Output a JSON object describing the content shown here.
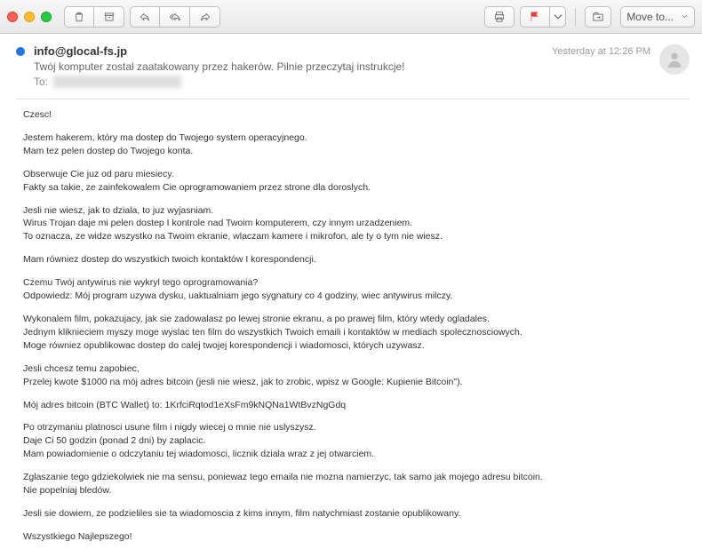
{
  "toolbar": {
    "move_to_button": "Move to..."
  },
  "header": {
    "from": "info@glocal-fs.jp",
    "subject": "Twój komputer zostal zaatakowany przez hakerów. Pilnie przeczytaj instrukcje!",
    "to_label": "To:",
    "to_value": "redacted@redacted.com",
    "date": "Yesterday at 12:26 PM"
  },
  "body": {
    "p1": "Czesc!",
    "p2": "Jestem hakerem, który ma dostep do Twojego system operacyjnego.\nMam tez pelen dostep do Twojego konta.",
    "p3": "Obserwuje Cie juz od paru miesiecy.\nFakty sa takie, ze zainfekowalem Cie oprogramowaniem przez strone dla doroslych.",
    "p4": "Jesli nie wiesz, jak to dziala, to juz wyjasniam.\nWirus Trojan daje mi pelen dostep I kontrole nad Twoim komputerem, czy innym urzadzeniem.\nTo oznacza, ze widze wszystko na Twoim ekranie, wlaczam kamere i mikrofon, ale ty o tym nie wiesz.",
    "p5": "Mam równiez dostep do wszystkich twoich kontaktów I korespondencji.",
    "p6": "Czemu Twój antywirus nie wykryl tego oprogramowania?\nOdpowiedz: Mój program uzywa dysku, uaktualniam jego sygnatury co 4 godziny, wiec antywirus milczy.",
    "p7": "Wykonalem film, pokazujacy, jak sie zadowalasz po lewej stronie ekranu, a po prawej film, który wtedy ogladales.\nJednym kliknieciem myszy moge wyslac ten film do wszystkich Twoich emaili i kontaktów w mediach spolecznosciowych.\nMoge równiez opublikowac dostep do calej twojej korespondencji i wiadomosci, których uzywasz.",
    "p8": "Jesli chcesz temu zapobiec,\nPrzelej kwote $1000 na mój adres bitcoin (jesli nie wiesz, jak to zrobic, wpisz w Google: Kupienie Bitcoin\").",
    "p9": "Mój adres bitcoin (BTC Wallet) to:  1KrfciRqtod1eXsFm9kNQNa1WtBvzNgGdq",
    "p10": "Po otrzymaniu platnosci usune film i nigdy wiecej o mnie nie uslyszysz.\nDaje Ci 50 godzin (ponad 2 dni) by zaplacic.\nMam powiadomienie o odczytaniu tej wiadomosci, licznik dziala wraz z jej otwarciem.",
    "p11": "Zglaszanie tego gdziekolwiek nie ma sensu, poniewaz tego emaila nie mozna namierzyc, tak samo jak mojego adresu bitcoin.\nNie popelniaj bledów.",
    "p12": "Jesli sie dowiem, ze podzieliles sie ta wiadomoscia z kims innym, film natychmiast zostanie opublikowany.",
    "p13": "Wszystkiego Najlepszego!"
  }
}
